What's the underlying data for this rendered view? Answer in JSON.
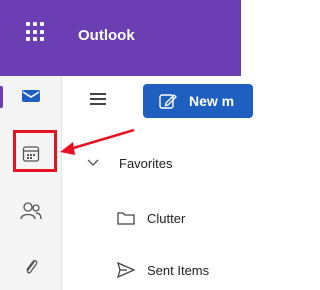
{
  "header": {
    "app_name": "Outlook",
    "background": "#6b3fb3"
  },
  "rail": {
    "items": [
      {
        "name": "mail",
        "icon": "mail-icon",
        "active": true
      },
      {
        "name": "calendar",
        "icon": "calendar-icon",
        "highlighted": true
      },
      {
        "name": "people",
        "icon": "people-icon"
      },
      {
        "name": "attachments",
        "icon": "paperclip-icon"
      }
    ]
  },
  "toolbar": {
    "new_button_label": "New m",
    "accent": "#1f5fbf"
  },
  "folders": {
    "favorites_label": "Favorites",
    "items": [
      {
        "label": "Clutter",
        "icon": "folder-icon"
      },
      {
        "label": "Sent Items",
        "icon": "send-icon"
      }
    ]
  },
  "annotation": {
    "color": "#e81123"
  }
}
